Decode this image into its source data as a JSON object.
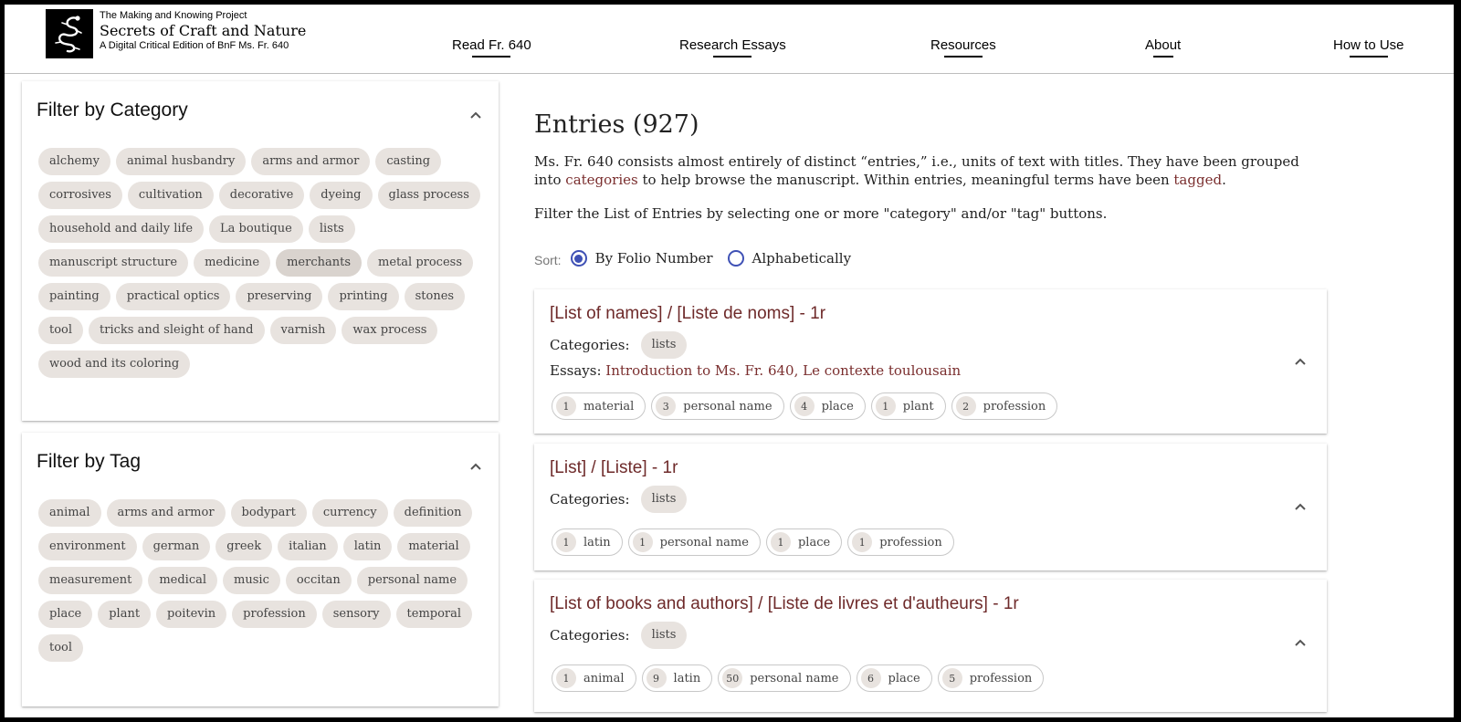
{
  "brand": {
    "project": "The Making and Knowing Project",
    "title": "Secrets of Craft and Nature",
    "subtitle": "A Digital Critical Edition of BnF Ms. Fr. 640"
  },
  "nav": [
    "Read Fr. 640",
    "Research Essays",
    "Resources",
    "About",
    "How to Use"
  ],
  "category_filter": {
    "title": "Filter by Category",
    "items": [
      "alchemy",
      "animal husbandry",
      "arms and armor",
      "casting",
      "corrosives",
      "cultivation",
      "decorative",
      "dyeing",
      "glass process",
      "household and daily life",
      "La boutique",
      "lists",
      "manuscript structure",
      "medicine",
      "merchants",
      "metal process",
      "painting",
      "practical optics",
      "preserving",
      "printing",
      "stones",
      "tool",
      "tricks and sleight of hand",
      "varnish",
      "wax process",
      "wood and its coloring"
    ],
    "active": "merchants"
  },
  "tag_filter": {
    "title": "Filter by Tag",
    "items": [
      "animal",
      "arms and armor",
      "bodypart",
      "currency",
      "definition",
      "environment",
      "german",
      "greek",
      "italian",
      "latin",
      "material",
      "measurement",
      "medical",
      "music",
      "occitan",
      "personal name",
      "place",
      "plant",
      "poitevin",
      "profession",
      "sensory",
      "temporal",
      "tool"
    ]
  },
  "main": {
    "title": "Entries (927)",
    "intro_1": "Ms. Fr. 640 consists almost entirely of distinct “entries,” i.e., units of text with titles. They have been grouped into ",
    "intro_link_1": "categories",
    "intro_2": " to help browse the manuscript. Within entries, meaningful terms have been ",
    "intro_link_2": "tagged",
    "intro_3": ".",
    "filter_text": "Filter the List of Entries by selecting one or more \"category\" and/or \"tag\" buttons.",
    "sort_label": "Sort:",
    "sort_options": [
      "By Folio Number",
      "Alphabetically"
    ],
    "sort_selected": "By Folio Number"
  },
  "entries": [
    {
      "title": "[List of names] / [Liste de noms] - 1r",
      "categories_label": "Categories:",
      "categories": [
        "lists"
      ],
      "essays_label": "Essays:",
      "essays": "Introduction to Ms. Fr. 640, Le contexte toulousain",
      "tags": [
        {
          "count": "1",
          "name": "material"
        },
        {
          "count": "3",
          "name": "personal name"
        },
        {
          "count": "4",
          "name": "place"
        },
        {
          "count": "1",
          "name": "plant"
        },
        {
          "count": "2",
          "name": "profession"
        }
      ]
    },
    {
      "title": "[List] / [Liste] - 1r",
      "categories_label": "Categories:",
      "categories": [
        "lists"
      ],
      "tags": [
        {
          "count": "1",
          "name": "latin"
        },
        {
          "count": "1",
          "name": "personal name"
        },
        {
          "count": "1",
          "name": "place"
        },
        {
          "count": "1",
          "name": "profession"
        }
      ]
    },
    {
      "title": "[List of books and authors] / [Liste de livres et d'autheurs] - 1r",
      "categories_label": "Categories:",
      "categories": [
        "lists"
      ],
      "tags": [
        {
          "count": "1",
          "name": "animal"
        },
        {
          "count": "9",
          "name": "latin"
        },
        {
          "count": "50",
          "name": "personal name"
        },
        {
          "count": "6",
          "name": "place"
        },
        {
          "count": "5",
          "name": "profession"
        }
      ]
    }
  ]
}
